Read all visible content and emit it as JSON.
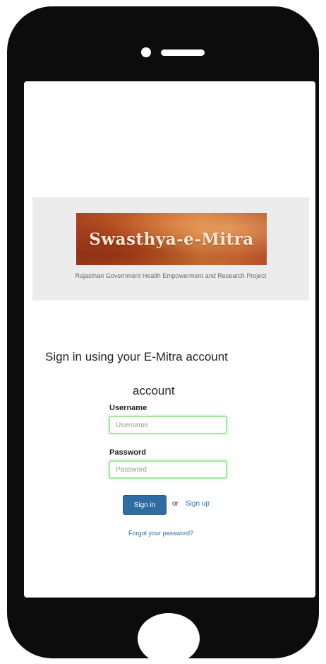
{
  "banner": {
    "title": "Swasthya-e-Mitra",
    "subtitle": "Rajasthan Government Health Empowerment and Research Project"
  },
  "signin": {
    "heading": "Sign in using your E-Mitra account",
    "heading_wrap": "account",
    "username_label": "Username",
    "username_placeholder": "Username",
    "password_label": "Password",
    "password_placeholder": "Password",
    "signin_button": "Sign in",
    "or_text": "or",
    "signup_link": "Sign up",
    "forgot_link": "Forgot your password?"
  },
  "colors": {
    "phone_body": "#0c0c0c",
    "primary_button": "#2e6da4",
    "input_border": "#a7e6a0"
  }
}
